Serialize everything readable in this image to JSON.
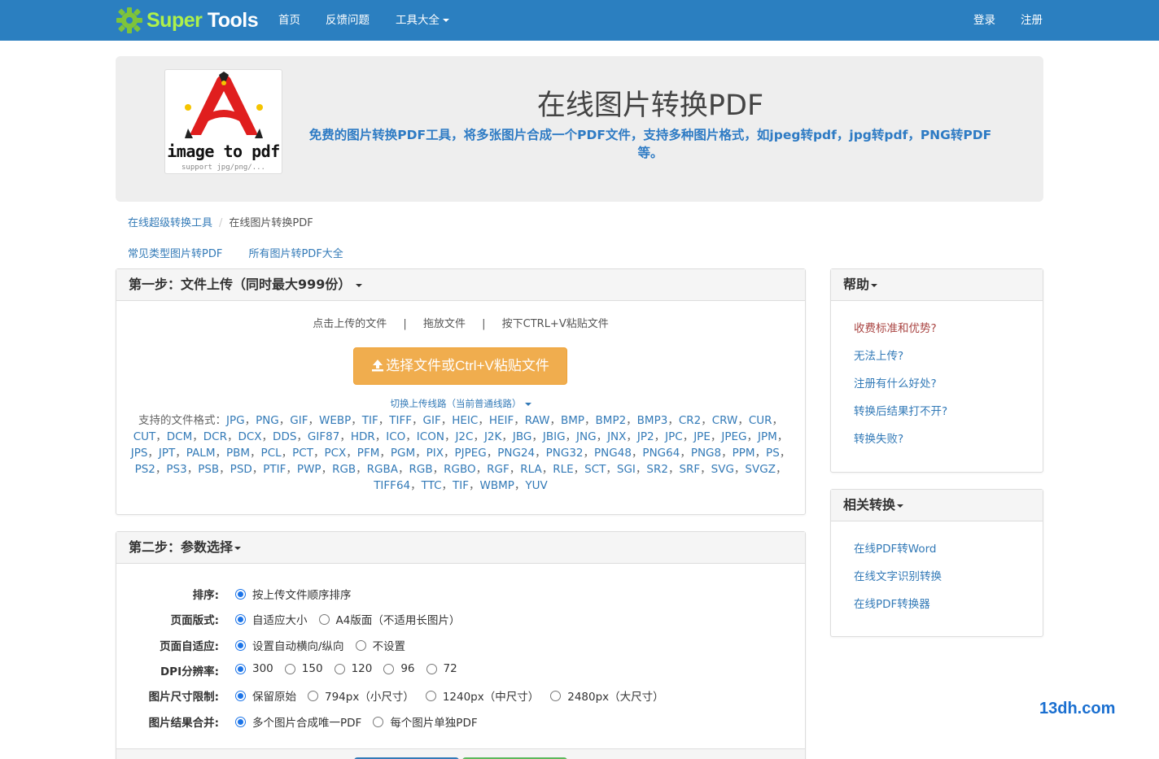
{
  "nav": {
    "brand_part1": "Super",
    "brand_part2": "Tools",
    "home": "首页",
    "feedback": "反馈问题",
    "tools": "工具大全",
    "login": "登录",
    "register": "注册"
  },
  "hero": {
    "logo_text": "image to pdf",
    "logo_sub": "support jpg/png/...",
    "title": "在线图片转换PDF",
    "description": "免费的图片转换PDF工具，将多张图片合成一个PDF文件，支持多种图片格式，如jpeg转pdf，jpg转pdf，PNG转PDF等。"
  },
  "breadcrumb": {
    "root": "在线超级转换工具",
    "current": "在线图片转换PDF"
  },
  "sublinks": [
    "常见类型图片转PDF",
    "所有图片转PDF大全"
  ],
  "step1": {
    "title": "第一步：文件上传（同时最大999份）",
    "hints": [
      "点击上传的文件",
      "拖放文件",
      "按下CTRL+V粘贴文件"
    ],
    "hint_separator": "|",
    "upload_button": "选择文件或Ctrl+V粘贴文件",
    "line_switch": "切换上传线路（当前普通线路）",
    "formats_label": "支持的文件格式：",
    "formats": [
      "JPG",
      "PNG",
      "GIF",
      "WEBP",
      "TIF",
      "TIFF",
      "GIF",
      "HEIC",
      "HEIF",
      "RAW",
      "BMP",
      "BMP2",
      "BMP3",
      "CR2",
      "CRW",
      "CUR",
      "CUT",
      "DCM",
      "DCR",
      "DCX",
      "DDS",
      "GIF87",
      "HDR",
      "ICO",
      "ICON",
      "J2C",
      "J2K",
      "JBG",
      "JBIG",
      "JNG",
      "JNX",
      "JP2",
      "JPC",
      "JPE",
      "JPEG",
      "JPM",
      "JPS",
      "JPT",
      "PALM",
      "PBM",
      "PCL",
      "PCT",
      "PCX",
      "PFM",
      "PGM",
      "PIX",
      "PJPEG",
      "PNG24",
      "PNG32",
      "PNG48",
      "PNG64",
      "PNG8",
      "PPM",
      "PS",
      "PS2",
      "PS3",
      "PSB",
      "PSD",
      "PTIF",
      "PWP",
      "RGB",
      "RGBA",
      "RGB",
      "RGBO",
      "RGF",
      "RLA",
      "RLE",
      "SCT",
      "SGI",
      "SR2",
      "SRF",
      "SVG",
      "SVGZ",
      "TIFF64",
      "TTC",
      "TIF",
      "WBMP",
      "YUV"
    ]
  },
  "step2": {
    "title": "第二步：参数选择",
    "rows": [
      {
        "label": "排序:",
        "options": [
          "按上传文件顺序排序"
        ],
        "selected": 0
      },
      {
        "label": "页面版式:",
        "options": [
          "自适应大小",
          "A4版面（不适用长图片）"
        ],
        "selected": 0
      },
      {
        "label": "页面自适应:",
        "options": [
          "设置自动横向/纵向",
          "不设置"
        ],
        "selected": 0
      },
      {
        "label": "DPI分辨率:",
        "options": [
          "300",
          "150",
          "120",
          "96",
          "72"
        ],
        "selected": 0
      },
      {
        "label": "图片尺寸限制:",
        "options": [
          "保留原始",
          "794px（小尺寸）",
          "1240px（中尺寸）",
          "2480px（大尺寸）"
        ],
        "selected": 0
      },
      {
        "label": "图片结果合并:",
        "options": [
          "多个图片合成唯一PDF",
          "每个图片单独PDF"
        ],
        "selected": 0
      }
    ]
  },
  "help": {
    "title": "帮助",
    "items": [
      "收费标准和优势?",
      "无法上传?",
      "注册有什么好处?",
      "转换后结果打不开?",
      "转换失败?"
    ]
  },
  "related": {
    "title": "相关转换",
    "items": [
      "在线PDF转Word",
      "在线文字识别转换",
      "在线PDF转换器"
    ]
  },
  "watermark": "13dh.com",
  "colors": {
    "navbar": "#2b7fc0",
    "upload_button": "#f0ad4e",
    "link": "#337ab7",
    "hero_desc": "#2e7bc4"
  }
}
